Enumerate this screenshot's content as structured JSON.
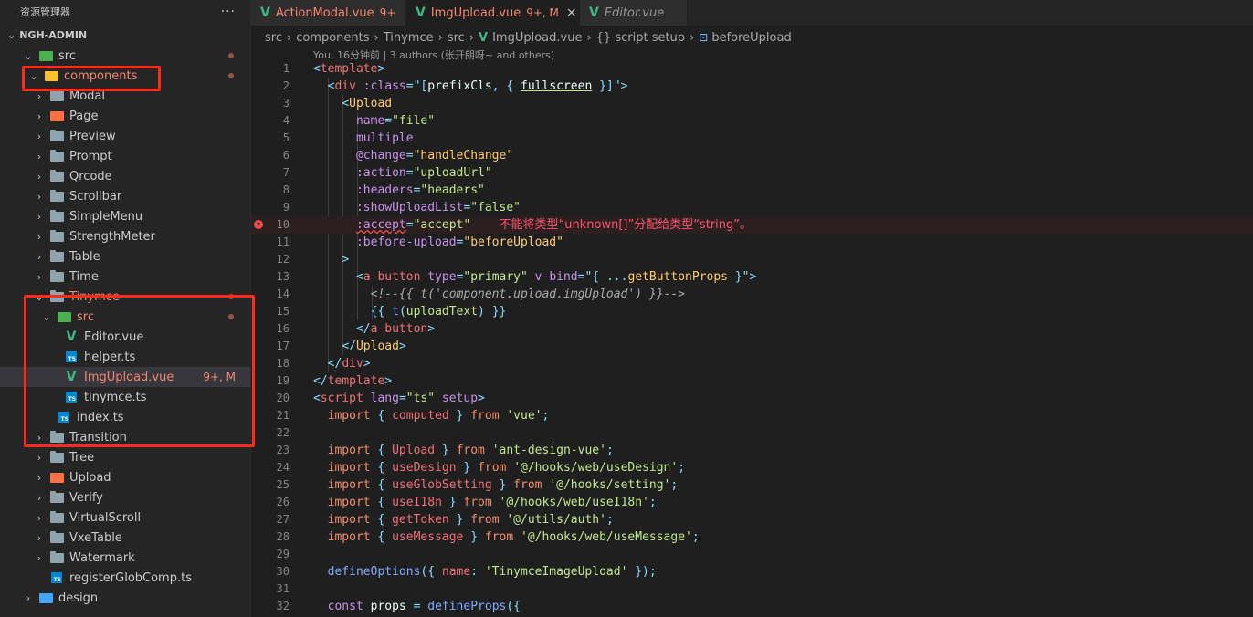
{
  "sidebar": {
    "title": "资源管理器",
    "more": "···",
    "section": "NGH-ADMIN",
    "items": [
      {
        "label": "src",
        "type": "folder-src",
        "depth": 1,
        "open": true,
        "dot": true
      },
      {
        "label": "components",
        "type": "folder-comp",
        "depth": 1.5,
        "open": true,
        "dot": true,
        "mod": true
      },
      {
        "label": "Modal",
        "type": "folder",
        "depth": 2
      },
      {
        "label": "Page",
        "type": "folder-page",
        "depth": 2
      },
      {
        "label": "Preview",
        "type": "folder",
        "depth": 2
      },
      {
        "label": "Prompt",
        "type": "folder",
        "depth": 2
      },
      {
        "label": "Qrcode",
        "type": "folder",
        "depth": 2
      },
      {
        "label": "Scrollbar",
        "type": "folder",
        "depth": 2
      },
      {
        "label": "SimpleMenu",
        "type": "folder",
        "depth": 2
      },
      {
        "label": "StrengthMeter",
        "type": "folder",
        "depth": 2
      },
      {
        "label": "Table",
        "type": "folder",
        "depth": 2
      },
      {
        "label": "Time",
        "type": "folder",
        "depth": 2
      },
      {
        "label": "Tinymce",
        "type": "folder",
        "depth": 2,
        "open": true,
        "dot": true,
        "mod": true
      },
      {
        "label": "src",
        "type": "folder-src",
        "depth": 3,
        "open": true,
        "dot": true,
        "mod": true
      },
      {
        "label": "Editor.vue",
        "type": "vue",
        "depth": 4
      },
      {
        "label": "helper.ts",
        "type": "ts",
        "depth": 4
      },
      {
        "label": "ImgUpload.vue",
        "type": "vue",
        "depth": 4,
        "selected": true,
        "err": true,
        "badge": "9+, M"
      },
      {
        "label": "tinymce.ts",
        "type": "ts",
        "depth": 4
      },
      {
        "label": "index.ts",
        "type": "ts",
        "depth": 3
      },
      {
        "label": "Transition",
        "type": "folder",
        "depth": 2
      },
      {
        "label": "Tree",
        "type": "folder",
        "depth": 2
      },
      {
        "label": "Upload",
        "type": "folder-upload",
        "depth": 2
      },
      {
        "label": "Verify",
        "type": "folder",
        "depth": 2
      },
      {
        "label": "VirtualScroll",
        "type": "folder",
        "depth": 2
      },
      {
        "label": "VxeTable",
        "type": "folder",
        "depth": 2
      },
      {
        "label": "Watermark",
        "type": "folder",
        "depth": 2
      },
      {
        "label": "registerGlobComp.ts",
        "type": "ts",
        "depth": 2
      },
      {
        "label": "design",
        "type": "folder-design",
        "depth": 1
      }
    ]
  },
  "tabs": [
    {
      "label": "ActionModal.vue",
      "badge": "9+",
      "active": false,
      "err": false
    },
    {
      "label": "ImgUpload.vue",
      "badge": "9+, M",
      "active": true,
      "err": true,
      "close": "×"
    },
    {
      "label": "Editor.vue",
      "badge": "",
      "active": false,
      "italic": true
    }
  ],
  "breadcrumb": {
    "parts": [
      "src",
      "components",
      "Tinymce",
      "src"
    ],
    "file": "ImgUpload.vue",
    "section": "{} script setup",
    "symbol": "beforeUpload"
  },
  "blame": "You, 16分钟前 | 3 authors (张开朗呀~ and others)",
  "error_message": "不能将类型“unknown[]”分配给类型“string”。",
  "line_numbers": [
    "1",
    "2",
    "3",
    "4",
    "5",
    "6",
    "7",
    "8",
    "9",
    "10",
    "11",
    "12",
    "13",
    "14",
    "15",
    "16",
    "17",
    "18",
    "19",
    "20",
    "21",
    "22",
    "23",
    "24",
    "25",
    "26",
    "27",
    "28",
    "29",
    "30",
    "31",
    "32"
  ],
  "code": {
    "l1_tag": "template",
    "l2_attr": ":class",
    "l2_v1": "prefixCls",
    "l2_v2": "fullscreen",
    "l3_tag": "Upload",
    "l4_attr": "name",
    "l4_val": "\"file\"",
    "l5_attr": "multiple",
    "l6_attr": "@change",
    "l6_val": "\"handleChange\"",
    "l7_attr": ":action",
    "l7_val": "\"uploadUrl\"",
    "l8_attr": ":headers",
    "l8_val": "\"headers\"",
    "l9_attr": ":showUploadList",
    "l9_val": "\"false\"",
    "l10_attr": ":accept",
    "l10_val": "\"accept\"",
    "l11_attr": ":before-upload",
    "l11_val": "\"beforeUpload\"",
    "l12_punc": ">",
    "l13_tag": "a-button",
    "l13_attr1": "type",
    "l13_val1": "\"primary\"",
    "l13_attr2": "v-bind",
    "l13_val2": "getButtonProps",
    "l14_comment": "<!--{{ t('component.upload.imgUpload') }}-->",
    "l15_fn": "t",
    "l15_arg": "uploadText",
    "l16_tag": "a-button",
    "l17_tag": "Upload",
    "l18_tag": "div",
    "l19_tag": "template",
    "l20_tag": "script",
    "l20_attr": "lang",
    "l20_val": "\"ts\"",
    "l20_attr2": "setup",
    "imports": [
      {
        "name": "computed",
        "from": "'vue'"
      },
      {
        "name": "Upload",
        "from": "'ant-design-vue'"
      },
      {
        "name": "useDesign",
        "from": "'@/hooks/web/useDesign'"
      },
      {
        "name": "useGlobSetting",
        "from": "'@/hooks/setting'"
      },
      {
        "name": "useI18n",
        "from": "'@/hooks/web/useI18n'"
      },
      {
        "name": "getToken",
        "from": "'@/utils/auth'"
      },
      {
        "name": "useMessage",
        "from": "'@/hooks/web/useMessage'"
      }
    ],
    "kw_import": "import",
    "kw_from": "from",
    "l30_fn": "defineOptions",
    "l30_key": "name",
    "l30_val": "'TinymceImageUpload'",
    "l32_kw": "const",
    "l32_var": "props",
    "l32_fn": "defineProps"
  }
}
